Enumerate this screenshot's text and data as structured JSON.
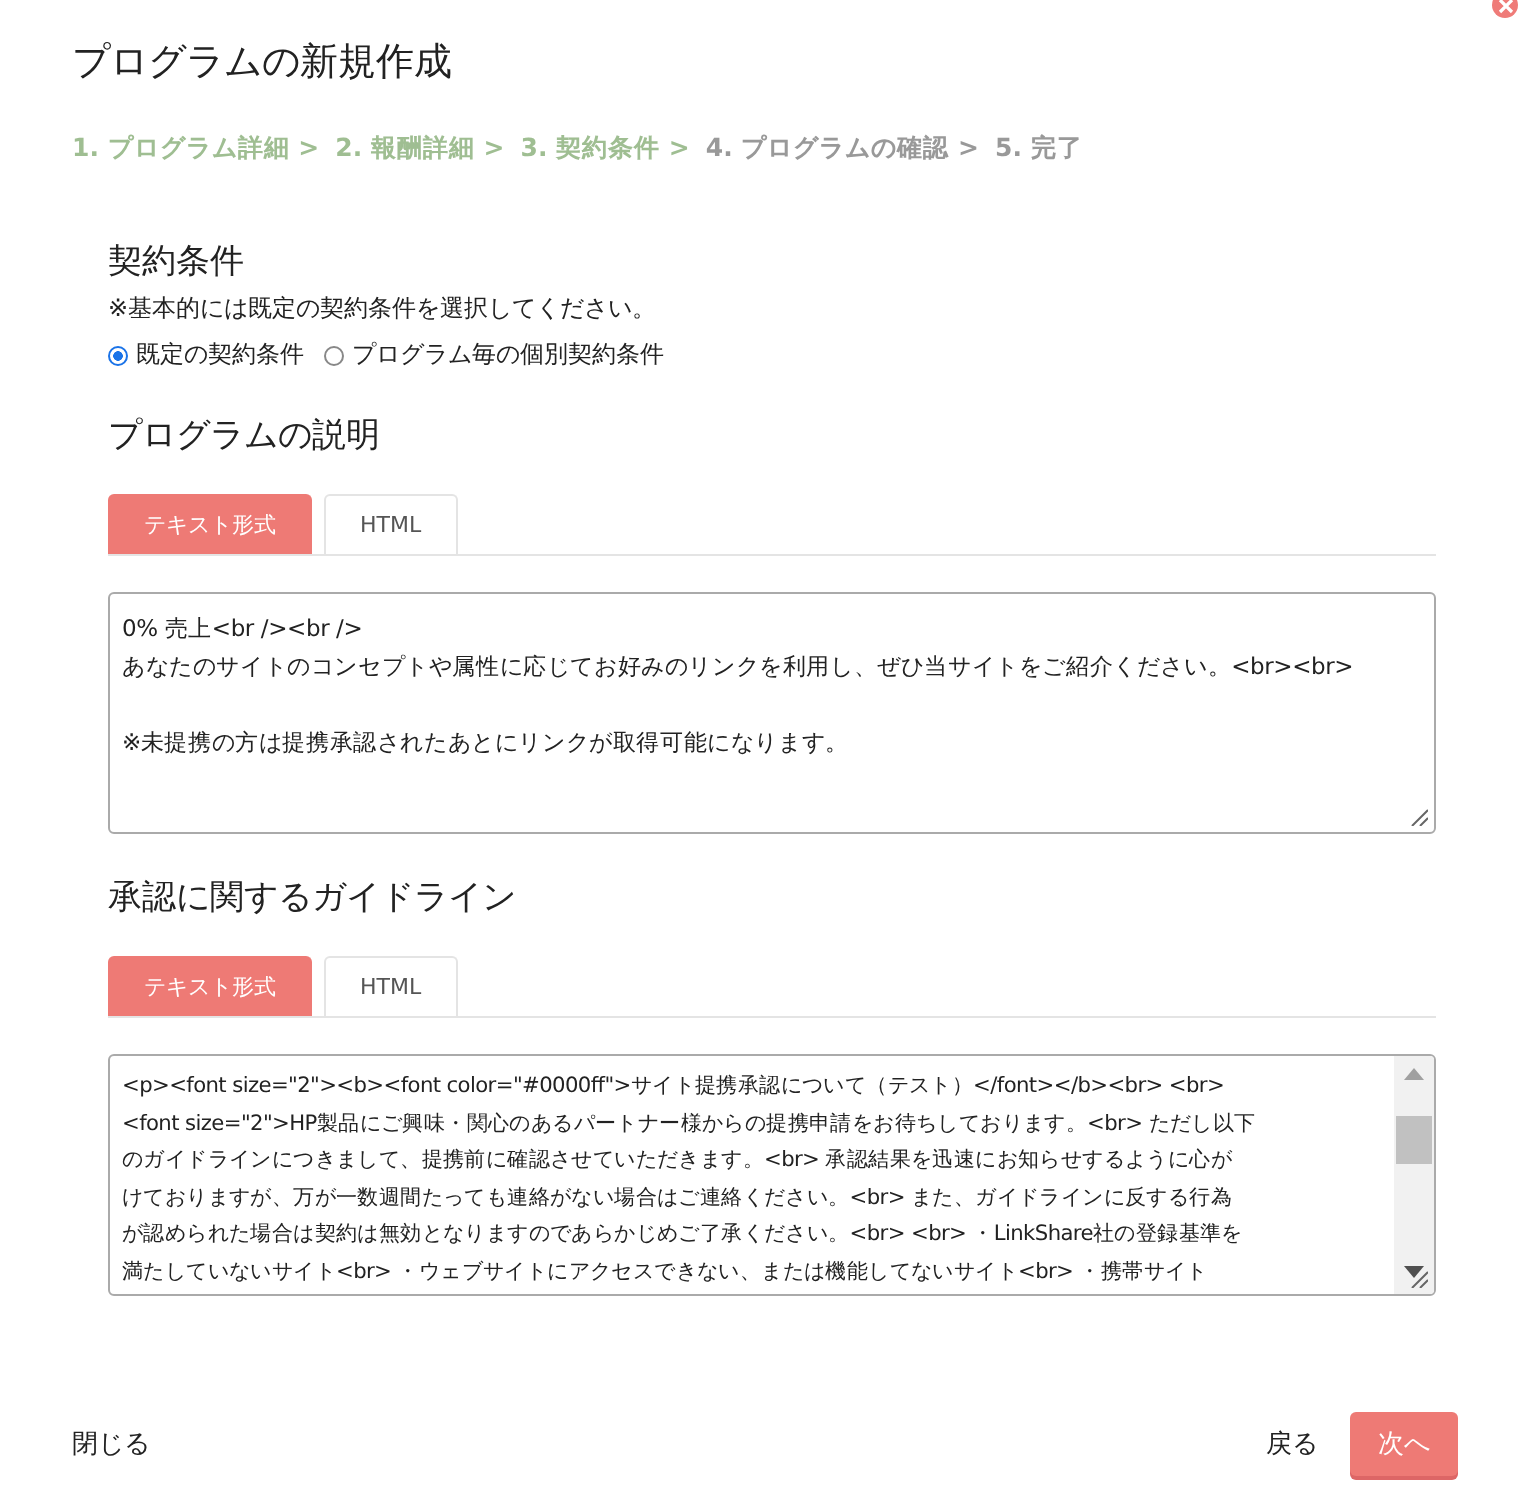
{
  "title": "プログラムの新規作成",
  "steps": [
    {
      "label": "1. プログラム詳細 >",
      "done": true
    },
    {
      "label": "2. 報酬詳細 >",
      "done": true
    },
    {
      "label": "3. 契約条件 >",
      "done": true
    },
    {
      "label": "4. プログラムの確認 >",
      "done": false
    },
    {
      "label": "5. 完了",
      "done": false
    }
  ],
  "contract": {
    "heading": "契約条件",
    "note": "※基本的には既定の契約条件を選択してください。",
    "options": [
      {
        "label": "既定の契約条件",
        "selected": true
      },
      {
        "label": "プログラム毎の個別契約条件",
        "selected": false
      }
    ]
  },
  "sections": [
    {
      "heading": "プログラムの説明",
      "tabs": [
        {
          "label": "テキスト形式",
          "selected": true
        },
        {
          "label": "HTML",
          "selected": false
        }
      ],
      "scrollbar": false,
      "paragraphs": [
        [
          "0% 売上<br /><br />",
          "あなたのサイトのコンセプトや属性に応じてお好みのリンクを利用し、ぜひ当サイトをご紹介ください。<br><br>"
        ],
        [
          "※未提携の方は提携承認されたあとにリンクが取得可能になります。"
        ]
      ]
    },
    {
      "heading": "承認に関するガイドライン",
      "tabs": [
        {
          "label": "テキスト形式",
          "selected": true
        },
        {
          "label": "HTML",
          "selected": false
        }
      ],
      "scrollbar": true,
      "paragraphs": [
        [
          "<p><font size=\"2\"><b><font color=\"#0000ff\">サイト提携承認について（テスト）</font></b><br> <br>",
          "<font size=\"2\">HP製品にご興味・関心のあるパートナー様からの提携申請をお待ちしております。<br> ただし以下",
          "のガイドラインにつきまして、提携前に確認させていただきます。<br> 承認結果を迅速にお知らせするように心が",
          "けておりますが、万が一数週間たっても連絡がない場合はご連絡ください。<br> また、ガイドラインに反する行為",
          "が認められた場合は契約は無効となりますのであらかじめご了承ください。<br> <br> ・LinkShare社の登録基準を",
          "満たしていないサイト<br> ・ウェブサイトにアクセスできない、または機能してないサイト<br> ・携帯サイト"
        ]
      ]
    }
  ],
  "footer": {
    "close": "閉じる",
    "back": "戻る",
    "next": "次へ"
  }
}
